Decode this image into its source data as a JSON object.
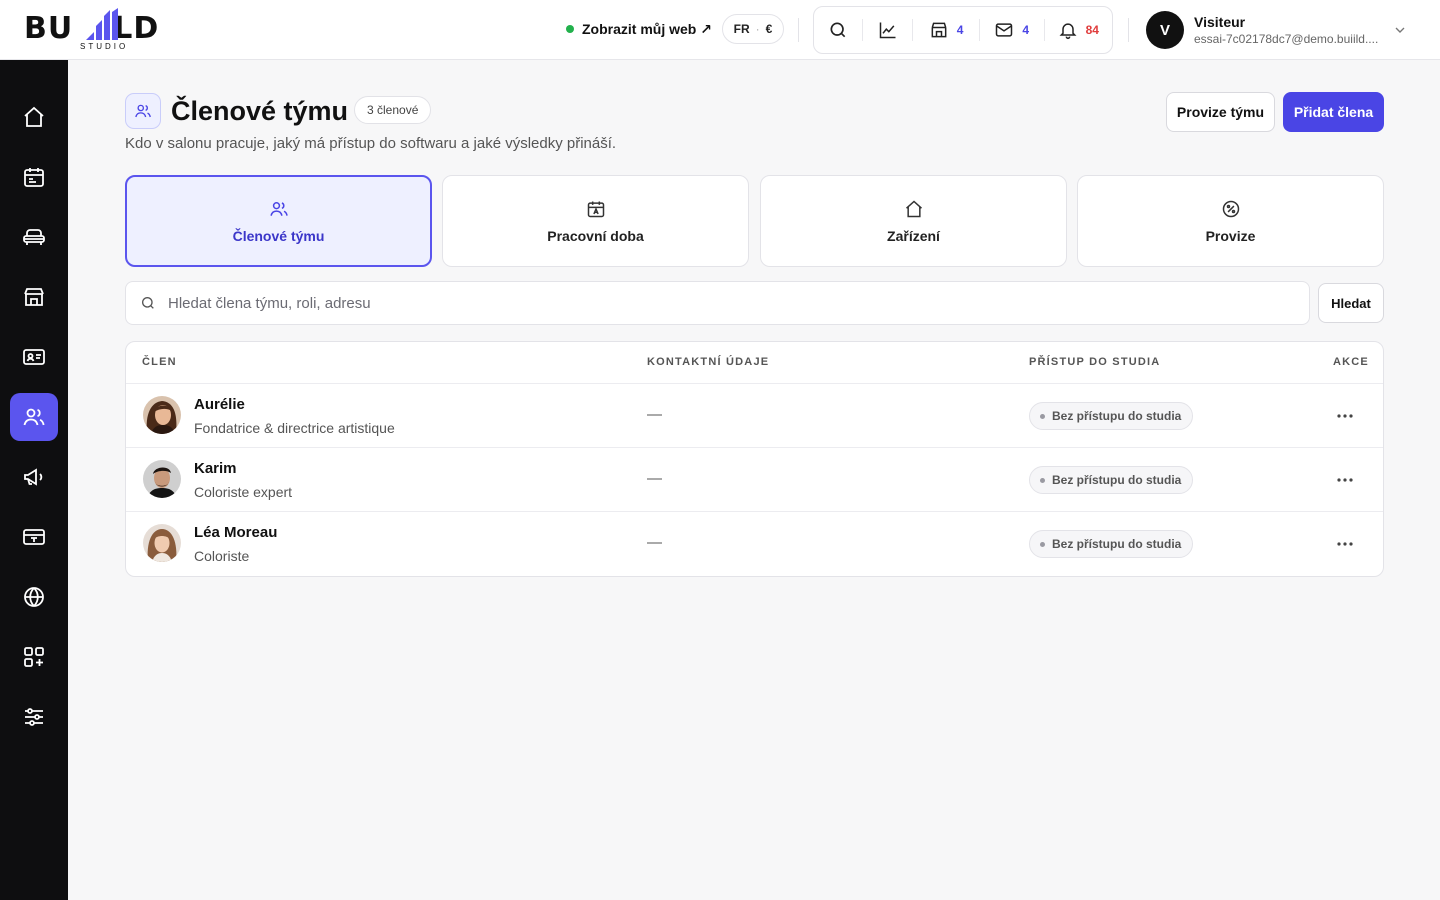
{
  "header": {
    "logo_text_left": "BU",
    "logo_text_right": "LD",
    "logo_subtitle": "STUDIO",
    "view_site": "Zobrazit můj web ↗",
    "lang": "FR",
    "currency": "€",
    "counts": {
      "stores": "4",
      "mail": "4",
      "notifications": "84"
    },
    "user": {
      "initial": "V",
      "name": "Visiteur",
      "email": "essai-7c02178dc7@demo.buiild...."
    },
    "colors": {
      "accent": "#4a45e5",
      "online": "#22b14c",
      "alert": "#e03c3c"
    }
  },
  "sidebar": {
    "items": [
      {
        "icon": "home-icon"
      },
      {
        "icon": "calendar-icon"
      },
      {
        "icon": "chair-icon"
      },
      {
        "icon": "store-icon"
      },
      {
        "icon": "contact-card-icon"
      },
      {
        "icon": "team-icon",
        "active": true
      },
      {
        "icon": "megaphone-icon"
      },
      {
        "icon": "payment-terminal-icon"
      },
      {
        "icon": "globe-icon"
      },
      {
        "icon": "apps-add-icon"
      },
      {
        "icon": "sliders-icon"
      }
    ]
  },
  "page": {
    "title": "Členové týmu",
    "badge": "3 členové",
    "subtitle": "Kdo v salonu pracuje, jaký má přístup do softwaru a jaké výsledky přináší.",
    "btn_commission": "Provize týmu",
    "btn_add": "Přidat člena"
  },
  "tabs": [
    {
      "label": "Členové týmu",
      "icon": "team-icon",
      "active": true
    },
    {
      "label": "Pracovní doba",
      "icon": "calendar-icon"
    },
    {
      "label": "Zařízení",
      "icon": "home-icon"
    },
    {
      "label": "Provize",
      "icon": "percent-icon"
    }
  ],
  "search": {
    "placeholder": "Hledat člena týmu, roli, adresu",
    "value": "",
    "button": "Hledat"
  },
  "table": {
    "columns": [
      "ČLEN",
      "KONTAKTNÍ ÚDAJE",
      "PŘÍSTUP DO STUDIA",
      "AKCE"
    ],
    "rows": [
      {
        "name": "Aurélie",
        "role": "Fondatrice & directrice artistique",
        "contact": "—",
        "access": "Bez přístupu do studia"
      },
      {
        "name": "Karim",
        "role": "Coloriste expert",
        "contact": "—",
        "access": "Bez přístupu do studia"
      },
      {
        "name": "Léa Moreau",
        "role": "Coloriste",
        "contact": "—",
        "access": "Bez přístupu do studia"
      }
    ]
  }
}
